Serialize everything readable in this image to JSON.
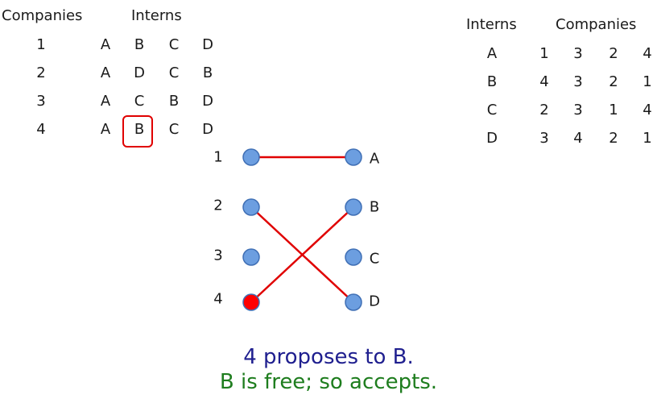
{
  "left_table": {
    "header_row": "Companies",
    "header_cols": "Interns",
    "rows": [
      {
        "label": "1",
        "prefs": [
          "A",
          "B",
          "C",
          "D"
        ]
      },
      {
        "label": "2",
        "prefs": [
          "A",
          "D",
          "C",
          "B"
        ]
      },
      {
        "label": "3",
        "prefs": [
          "A",
          "C",
          "B",
          "D"
        ]
      },
      {
        "label": "4",
        "prefs": [
          "A",
          "B",
          "C",
          "D"
        ]
      }
    ]
  },
  "right_table": {
    "header_row": "Interns",
    "header_cols": "Companies",
    "rows": [
      {
        "label": "A",
        "prefs": [
          "1",
          "3",
          "2",
          "4"
        ]
      },
      {
        "label": "B",
        "prefs": [
          "4",
          "3",
          "2",
          "1"
        ]
      },
      {
        "label": "C",
        "prefs": [
          "2",
          "3",
          "1",
          "4"
        ]
      },
      {
        "label": "D",
        "prefs": [
          "3",
          "4",
          "2",
          "1"
        ]
      }
    ]
  },
  "graph": {
    "left_nodes": [
      "1",
      "2",
      "3",
      "4"
    ],
    "right_nodes": [
      "A",
      "B",
      "C",
      "D"
    ],
    "edges": [
      [
        "1",
        "A"
      ],
      [
        "2",
        "D"
      ],
      [
        "4",
        "B"
      ]
    ],
    "active_node": "4"
  },
  "caption": {
    "line1": "4 proposes to B.",
    "line2": "B is free; so accepts."
  },
  "colors": {
    "node_fill": "#6c9ee0",
    "node_stroke": "#3f6fb5",
    "active_fill": "#ff0000",
    "edge": "#e00000",
    "caption1": "#1f1f8f",
    "caption2": "#1e7d1e"
  }
}
